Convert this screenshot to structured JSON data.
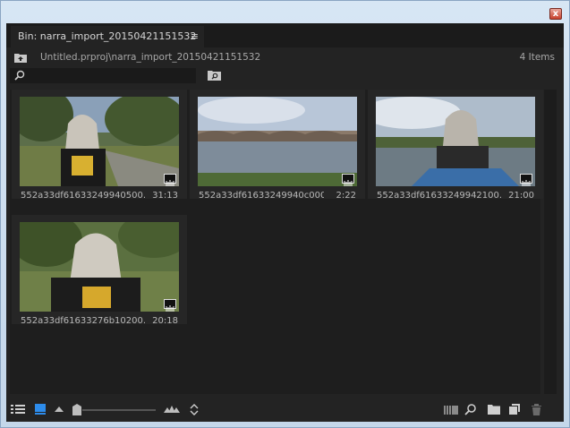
{
  "window": {
    "close_icon": "close-icon",
    "close_glyph": "x"
  },
  "panel": {
    "tab_title": "Bin: narra_import_20150421151532",
    "tab_menu_glyph": "≡",
    "path": "Untitled.prproj\\narra_import_20150421151532",
    "items_count": "4 Items",
    "search": {
      "value": "",
      "placeholder": ""
    }
  },
  "clips": [
    {
      "name": "552a33df61633249940500...",
      "duration": "31:13",
      "scene": "park"
    },
    {
      "name": "552a33df61633249940c0000...",
      "duration": "2:22",
      "scene": "river"
    },
    {
      "name": "552a33df61633249942100...",
      "duration": "21:00",
      "scene": "boat"
    },
    {
      "name": "552a33df61633276b10200...",
      "duration": "20:18",
      "scene": "portrait"
    }
  ],
  "bottombar": {
    "icons": [
      "list-view-icon",
      "icon-view-icon",
      "zoom-small-icon",
      "zoom-slider",
      "zoom-large-icon",
      "sort-icon",
      "automate-to-sequence-icon",
      "find-icon",
      "new-bin-icon",
      "new-item-icon",
      "clear-icon"
    ],
    "zoom_level": 0.1
  },
  "colors": {
    "panel_bg": "#232323",
    "accent_blue": "#2d8ceb"
  }
}
